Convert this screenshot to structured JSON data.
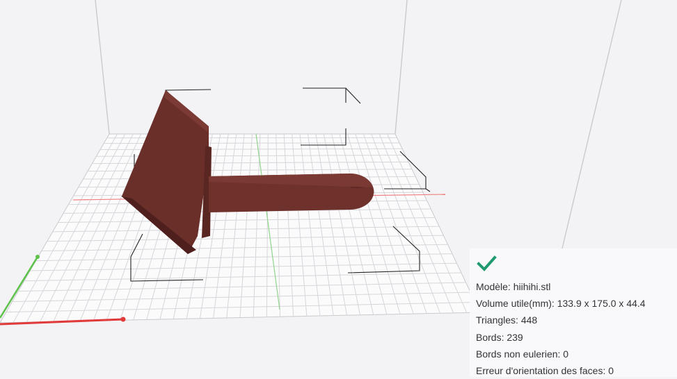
{
  "viewport": {
    "background": "#f3f3f5",
    "model_color": "#6b2f2a",
    "grid_color": "#d7d7dc",
    "axis_x_color": "#e03a3a",
    "axis_y_color": "#5cc24a"
  },
  "status": {
    "icon": "checkmark-icon",
    "color": "#1e9a6e"
  },
  "info": {
    "model": "Modèle: hiihihi.stl",
    "volume": "Volume utile(mm): 133.9 x 175.0 x 44.4",
    "triangles": "Triangles: 448",
    "edges": "Bords: 239",
    "non_eulerian": "Bords non eulerien: 0",
    "orientation_errors": "Erreur d'orientation des faces: 0"
  }
}
